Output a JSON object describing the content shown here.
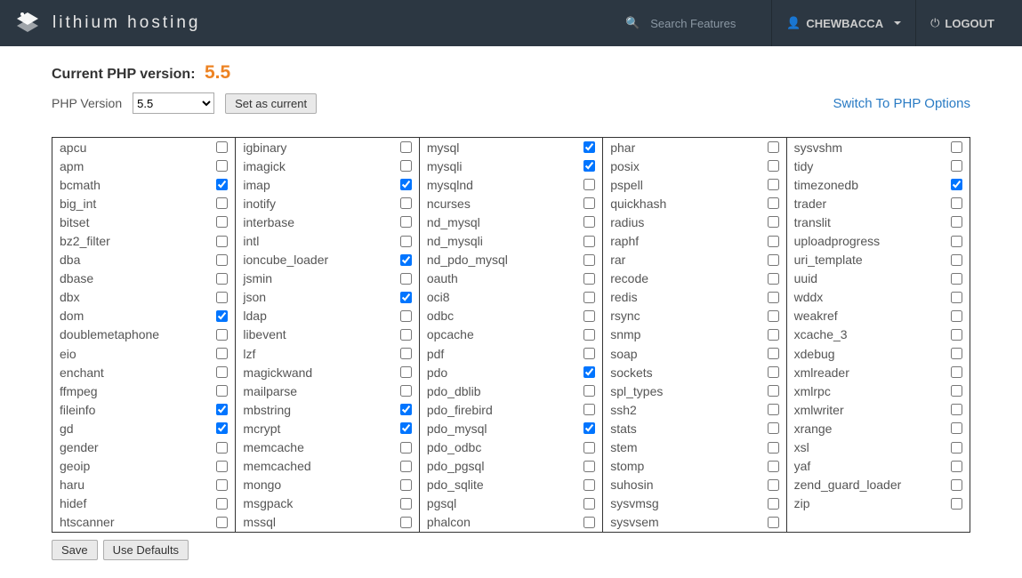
{
  "header": {
    "brand": "lithium hosting",
    "search_placeholder": "Search Features",
    "username": "CHEWBACCA",
    "logout": "LOGOUT"
  },
  "php": {
    "current_label": "Current PHP version:",
    "current_version": "5.5",
    "version_label": "PHP Version",
    "selected": "5.5",
    "set_current": "Set as current",
    "switch_link": "Switch To PHP Options",
    "save": "Save",
    "use_defaults": "Use Defaults"
  },
  "columns": [
    [
      {
        "name": "apcu",
        "checked": false
      },
      {
        "name": "apm",
        "checked": false
      },
      {
        "name": "bcmath",
        "checked": true
      },
      {
        "name": "big_int",
        "checked": false
      },
      {
        "name": "bitset",
        "checked": false
      },
      {
        "name": "bz2_filter",
        "checked": false
      },
      {
        "name": "dba",
        "checked": false
      },
      {
        "name": "dbase",
        "checked": false
      },
      {
        "name": "dbx",
        "checked": false
      },
      {
        "name": "dom",
        "checked": true
      },
      {
        "name": "doublemetaphone",
        "checked": false
      },
      {
        "name": "eio",
        "checked": false
      },
      {
        "name": "enchant",
        "checked": false
      },
      {
        "name": "ffmpeg",
        "checked": false
      },
      {
        "name": "fileinfo",
        "checked": true
      },
      {
        "name": "gd",
        "checked": true
      },
      {
        "name": "gender",
        "checked": false
      },
      {
        "name": "geoip",
        "checked": false
      },
      {
        "name": "haru",
        "checked": false
      },
      {
        "name": "hidef",
        "checked": false
      },
      {
        "name": "htscanner",
        "checked": false
      }
    ],
    [
      {
        "name": "igbinary",
        "checked": false
      },
      {
        "name": "imagick",
        "checked": false
      },
      {
        "name": "imap",
        "checked": true
      },
      {
        "name": "inotify",
        "checked": false
      },
      {
        "name": "interbase",
        "checked": false
      },
      {
        "name": "intl",
        "checked": false
      },
      {
        "name": "ioncube_loader",
        "checked": true
      },
      {
        "name": "jsmin",
        "checked": false
      },
      {
        "name": "json",
        "checked": true
      },
      {
        "name": "ldap",
        "checked": false
      },
      {
        "name": "libevent",
        "checked": false
      },
      {
        "name": "lzf",
        "checked": false
      },
      {
        "name": "magickwand",
        "checked": false
      },
      {
        "name": "mailparse",
        "checked": false
      },
      {
        "name": "mbstring",
        "checked": true
      },
      {
        "name": "mcrypt",
        "checked": true
      },
      {
        "name": "memcache",
        "checked": false
      },
      {
        "name": "memcached",
        "checked": false
      },
      {
        "name": "mongo",
        "checked": false
      },
      {
        "name": "msgpack",
        "checked": false
      },
      {
        "name": "mssql",
        "checked": false
      }
    ],
    [
      {
        "name": "mysql",
        "checked": true
      },
      {
        "name": "mysqli",
        "checked": true
      },
      {
        "name": "mysqlnd",
        "checked": false
      },
      {
        "name": "ncurses",
        "checked": false
      },
      {
        "name": "nd_mysql",
        "checked": false
      },
      {
        "name": "nd_mysqli",
        "checked": false
      },
      {
        "name": "nd_pdo_mysql",
        "checked": false
      },
      {
        "name": "oauth",
        "checked": false
      },
      {
        "name": "oci8",
        "checked": false
      },
      {
        "name": "odbc",
        "checked": false
      },
      {
        "name": "opcache",
        "checked": false
      },
      {
        "name": "pdf",
        "checked": false
      },
      {
        "name": "pdo",
        "checked": true
      },
      {
        "name": "pdo_dblib",
        "checked": false
      },
      {
        "name": "pdo_firebird",
        "checked": false
      },
      {
        "name": "pdo_mysql",
        "checked": true
      },
      {
        "name": "pdo_odbc",
        "checked": false
      },
      {
        "name": "pdo_pgsql",
        "checked": false
      },
      {
        "name": "pdo_sqlite",
        "checked": false
      },
      {
        "name": "pgsql",
        "checked": false
      },
      {
        "name": "phalcon",
        "checked": false
      }
    ],
    [
      {
        "name": "phar",
        "checked": false
      },
      {
        "name": "posix",
        "checked": false
      },
      {
        "name": "pspell",
        "checked": false
      },
      {
        "name": "quickhash",
        "checked": false
      },
      {
        "name": "radius",
        "checked": false
      },
      {
        "name": "raphf",
        "checked": false
      },
      {
        "name": "rar",
        "checked": false
      },
      {
        "name": "recode",
        "checked": false
      },
      {
        "name": "redis",
        "checked": false
      },
      {
        "name": "rsync",
        "checked": false
      },
      {
        "name": "snmp",
        "checked": false
      },
      {
        "name": "soap",
        "checked": false
      },
      {
        "name": "sockets",
        "checked": false
      },
      {
        "name": "spl_types",
        "checked": false
      },
      {
        "name": "ssh2",
        "checked": false
      },
      {
        "name": "stats",
        "checked": false
      },
      {
        "name": "stem",
        "checked": false
      },
      {
        "name": "stomp",
        "checked": false
      },
      {
        "name": "suhosin",
        "checked": false
      },
      {
        "name": "sysvmsg",
        "checked": false
      },
      {
        "name": "sysvsem",
        "checked": false
      }
    ],
    [
      {
        "name": "sysvshm",
        "checked": false
      },
      {
        "name": "tidy",
        "checked": false
      },
      {
        "name": "timezonedb",
        "checked": true
      },
      {
        "name": "trader",
        "checked": false
      },
      {
        "name": "translit",
        "checked": false
      },
      {
        "name": "uploadprogress",
        "checked": false
      },
      {
        "name": "uri_template",
        "checked": false
      },
      {
        "name": "uuid",
        "checked": false
      },
      {
        "name": "wddx",
        "checked": false
      },
      {
        "name": "weakref",
        "checked": false
      },
      {
        "name": "xcache_3",
        "checked": false
      },
      {
        "name": "xdebug",
        "checked": false
      },
      {
        "name": "xmlreader",
        "checked": false
      },
      {
        "name": "xmlrpc",
        "checked": false
      },
      {
        "name": "xmlwriter",
        "checked": false
      },
      {
        "name": "xrange",
        "checked": false
      },
      {
        "name": "xsl",
        "checked": false
      },
      {
        "name": "yaf",
        "checked": false
      },
      {
        "name": "zend_guard_loader",
        "checked": false
      },
      {
        "name": "zip",
        "checked": false
      }
    ]
  ]
}
